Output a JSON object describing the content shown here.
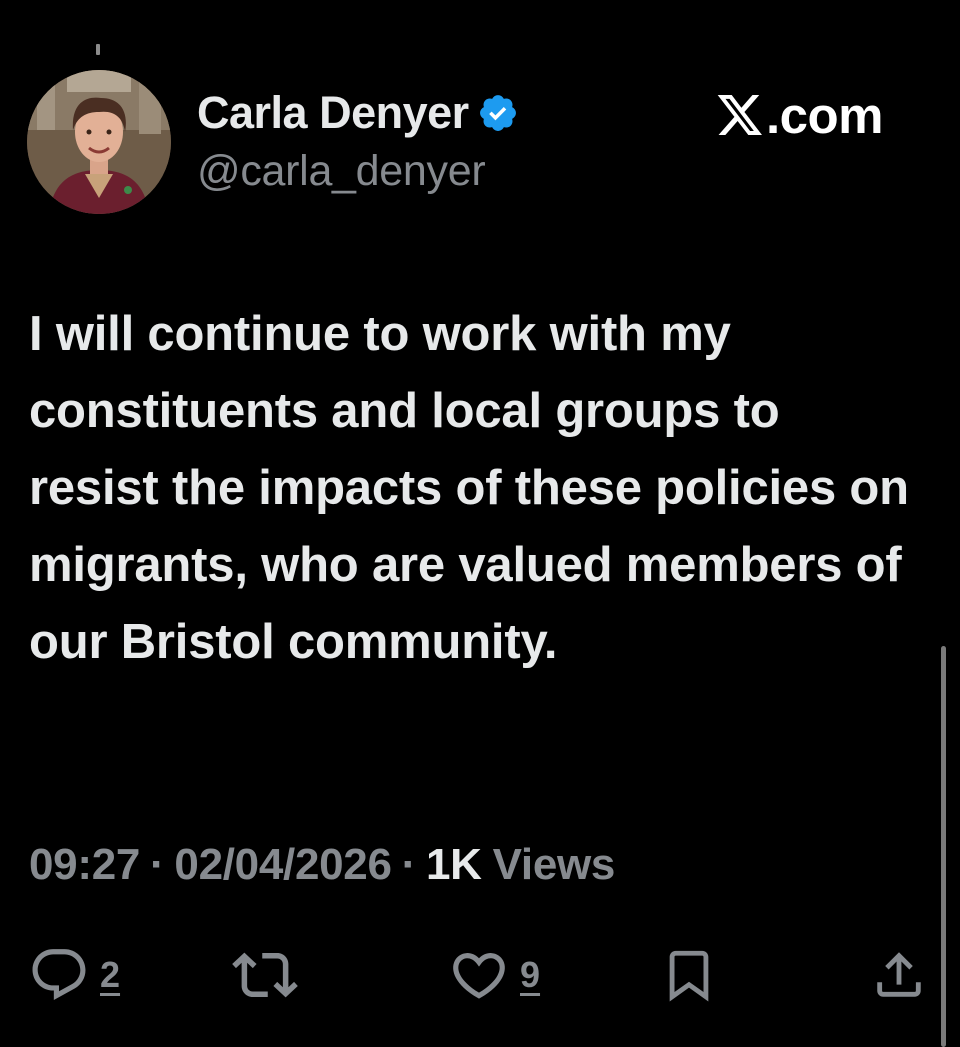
{
  "author": {
    "name": "Carla Denyer",
    "handle": "@carla_denyer",
    "verified": true,
    "verified_color": "#1d9bf0"
  },
  "site_label": ".com",
  "site_logo_icon": "x-logo-icon",
  "tweet": {
    "text": "I will continue to work with my constituents and local groups to resist the impacts of these policies on migrants, who are valued members of our Bristol community."
  },
  "meta": {
    "time": "09:27",
    "date": "02/04/2026",
    "views_count": "1K",
    "views_label": "Views",
    "separator": "·"
  },
  "actions": {
    "reply": {
      "icon": "reply-icon",
      "count": "2"
    },
    "repost": {
      "icon": "repost-icon",
      "count": ""
    },
    "like": {
      "icon": "heart-icon",
      "count": "9"
    },
    "bookmark": {
      "icon": "bookmark-icon",
      "count": ""
    },
    "share": {
      "icon": "share-icon",
      "count": ""
    }
  },
  "colors": {
    "background": "#000000",
    "primary_text": "#e7e9ea",
    "secondary_text": "#868a8f"
  }
}
